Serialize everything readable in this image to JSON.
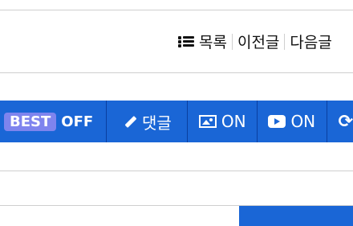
{
  "nav": {
    "list_label": "목록",
    "prev_label": "이전글",
    "next_label": "다음글"
  },
  "toolbar": {
    "best_badge": "BEST",
    "best_state": "OFF",
    "comment_label": "댓글",
    "image_state": "ON",
    "video_state": "ON",
    "more_icon": "refresh-icon"
  },
  "colors": {
    "toolbar_bg": "#1a66d6",
    "best_badge_bg": "#7e84ee"
  }
}
